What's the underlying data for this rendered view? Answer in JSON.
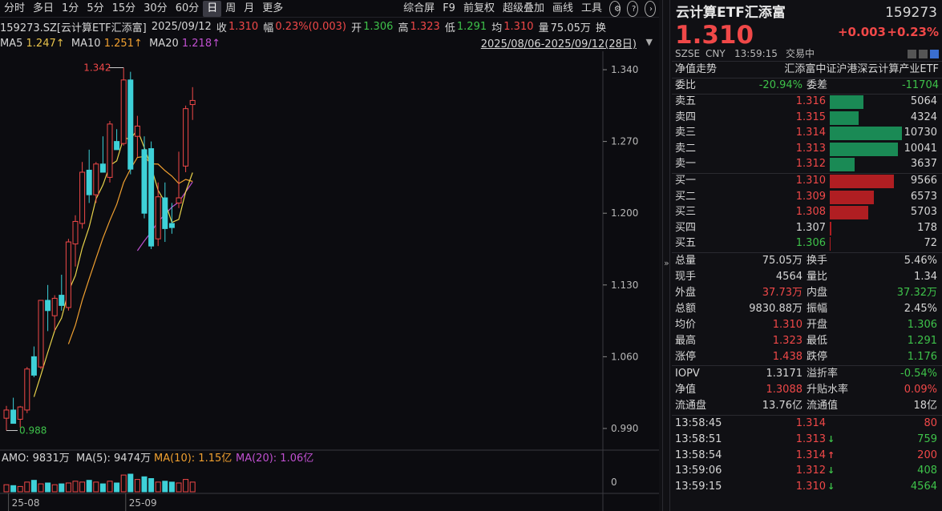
{
  "toolbar": {
    "timeframes": [
      "分时",
      "多日",
      "1分",
      "5分",
      "15分",
      "30分",
      "60分",
      "日",
      "周",
      "月",
      "更多"
    ],
    "active": "日",
    "tools": [
      "综合屏",
      "F9",
      "前复权",
      "超级叠加",
      "画线",
      "工具"
    ]
  },
  "info": {
    "code": "159273.SZ[云计算ETF汇添富]",
    "date": "2025/09/12",
    "close_label": "收",
    "close": "1.310",
    "amp_label": "幅",
    "amp": "0.23%(0.003)",
    "open_label": "开",
    "open": "1.306",
    "high_label": "高",
    "high": "1.323",
    "low_label": "低",
    "low": "1.291",
    "avg_label": "均",
    "avg": "1.310",
    "vol_label": "量",
    "vol": "75.05万",
    "more": "换"
  },
  "ma": {
    "ma5_label": "MA5",
    "ma5": "1.247↑",
    "ma10_label": "MA10",
    "ma10": "1.251↑",
    "ma20_label": "MA20",
    "ma20": "1.218↑"
  },
  "date_range": "2025/08/06-2025/09/12(28日)",
  "chart_data": {
    "type": "candlestick",
    "yticks": [
      "1.340",
      "1.270",
      "1.200",
      "1.130",
      "1.060",
      "0.990"
    ],
    "ylim": [
      0.972,
      1.358
    ],
    "max_label": "1.342",
    "min_label": "0.988",
    "candles": [
      {
        "o": 1.0,
        "h": 1.012,
        "l": 0.988,
        "c": 1.008
      },
      {
        "o": 1.008,
        "h": 1.02,
        "l": 0.995,
        "c": 0.995
      },
      {
        "o": 0.999,
        "h": 1.012,
        "l": 0.991,
        "c": 1.011
      },
      {
        "o": 1.008,
        "h": 1.05,
        "l": 1.005,
        "c": 1.048
      },
      {
        "o": 1.06,
        "h": 1.07,
        "l": 1.04,
        "c": 1.042
      },
      {
        "o": 1.05,
        "h": 1.115,
        "l": 1.048,
        "c": 1.115
      },
      {
        "o": 1.115,
        "h": 1.13,
        "l": 1.085,
        "c": 1.105
      },
      {
        "o": 1.1,
        "h": 1.12,
        "l": 1.085,
        "c": 1.117
      },
      {
        "o": 1.12,
        "h": 1.14,
        "l": 1.105,
        "c": 1.11
      },
      {
        "o": 1.108,
        "h": 1.175,
        "l": 1.105,
        "c": 1.172
      },
      {
        "o": 1.17,
        "h": 1.198,
        "l": 1.148,
        "c": 1.192
      },
      {
        "o": 1.19,
        "h": 1.25,
        "l": 1.185,
        "c": 1.24
      },
      {
        "o": 1.242,
        "h": 1.262,
        "l": 1.21,
        "c": 1.218
      },
      {
        "o": 1.218,
        "h": 1.25,
        "l": 1.21,
        "c": 1.248
      },
      {
        "o": 1.248,
        "h": 1.275,
        "l": 1.24,
        "c": 1.24
      },
      {
        "o": 1.235,
        "h": 1.29,
        "l": 1.23,
        "c": 1.287
      },
      {
        "o": 1.27,
        "h": 1.282,
        "l": 1.262,
        "c": 1.262
      },
      {
        "o": 1.268,
        "h": 1.342,
        "l": 1.266,
        "c": 1.33
      },
      {
        "o": 1.33,
        "h": 1.338,
        "l": 1.238,
        "c": 1.243
      },
      {
        "o": 1.275,
        "h": 1.295,
        "l": 1.255,
        "c": 1.285
      },
      {
        "o": 1.262,
        "h": 1.275,
        "l": 1.195,
        "c": 1.2
      },
      {
        "o": 1.263,
        "h": 1.27,
        "l": 1.165,
        "c": 1.168
      },
      {
        "o": 1.175,
        "h": 1.23,
        "l": 1.168,
        "c": 1.216
      },
      {
        "o": 1.215,
        "h": 1.23,
        "l": 1.172,
        "c": 1.185
      },
      {
        "o": 1.19,
        "h": 1.21,
        "l": 1.18,
        "c": 1.186
      },
      {
        "o": 1.21,
        "h": 1.26,
        "l": 1.205,
        "c": 1.215
      },
      {
        "o": 1.246,
        "h": 1.305,
        "l": 1.24,
        "c": 1.302
      },
      {
        "o": 1.306,
        "h": 1.323,
        "l": 1.291,
        "c": 1.31
      }
    ],
    "ma5_start_index": 4,
    "ma10_start_index": 9,
    "ma20_start_index": 19,
    "ma5_color": "#e8d24a",
    "ma10_color": "#f0a030",
    "ma20_color": "#c050d0",
    "up_color": "#f04848",
    "down_color": "#3ed1d8",
    "volumes": [
      0.4,
      0.35,
      0.3,
      0.55,
      0.65,
      0.45,
      0.5,
      0.4,
      0.45,
      0.5,
      0.6,
      0.55,
      0.65,
      0.55,
      0.45,
      0.6,
      0.5,
      0.95,
      1.0,
      0.7,
      0.85,
      0.75,
      0.55,
      0.6,
      0.55,
      0.5,
      0.7,
      0.55
    ],
    "xticks": [
      {
        "label": "25-08",
        "index": 1
      },
      {
        "label": "25-09",
        "index": 18
      }
    ],
    "vol_zero": "0"
  },
  "amo": {
    "label": "AMO:",
    "value": "9831万",
    "ma5": "MA(5): 9474万",
    "ma10": "MA(10): 1.15亿",
    "ma20": "MA(20): 1.06亿"
  },
  "panel": {
    "name": "云计算ETF汇添富",
    "code": "159273",
    "price": "1.310",
    "change": "+0.003",
    "change_pct": "+0.23%",
    "market": "SZSE",
    "currency": "CNY",
    "time": "13:59:15",
    "status": "交易中",
    "nav_trend": "净值走势",
    "index_name": "汇添富中证沪港深云计算产业ETF",
    "webi_label": "委比",
    "webi": "-20.94%",
    "wecha_label": "委差",
    "wecha": "-11704",
    "asks": [
      {
        "label": "卖五",
        "price": "1.316",
        "vol": "5064",
        "ratio": 0.47
      },
      {
        "label": "卖四",
        "price": "1.315",
        "vol": "4324",
        "ratio": 0.4
      },
      {
        "label": "卖三",
        "price": "1.314",
        "vol": "10730",
        "ratio": 1.0
      },
      {
        "label": "卖二",
        "price": "1.313",
        "vol": "10041",
        "ratio": 0.94
      },
      {
        "label": "卖一",
        "price": "1.312",
        "vol": "3637",
        "ratio": 0.34
      }
    ],
    "bids": [
      {
        "label": "买一",
        "price": "1.310",
        "vol": "9566",
        "ratio": 0.89,
        "color": "r"
      },
      {
        "label": "买二",
        "price": "1.309",
        "vol": "6573",
        "ratio": 0.61,
        "color": "r"
      },
      {
        "label": "买三",
        "price": "1.308",
        "vol": "5703",
        "ratio": 0.53,
        "color": "r"
      },
      {
        "label": "买四",
        "price": "1.307",
        "vol": "178",
        "ratio": 0.02,
        "color": "w"
      },
      {
        "label": "买五",
        "price": "1.306",
        "vol": "72",
        "ratio": 0.01,
        "color": "g"
      }
    ],
    "stats": [
      {
        "l1": "总量",
        "v1": "75.05万",
        "c1": "w",
        "l2": "换手",
        "v2": "5.46%",
        "c2": "w"
      },
      {
        "l1": "现手",
        "v1": "4564",
        "c1": "w",
        "l2": "量比",
        "v2": "1.34",
        "c2": "w"
      },
      {
        "l1": "外盘",
        "v1": "37.73万",
        "c1": "r",
        "l2": "内盘",
        "v2": "37.32万",
        "c2": "g"
      },
      {
        "l1": "总额",
        "v1": "9830.88万",
        "c1": "w",
        "l2": "振幅",
        "v2": "2.45%",
        "c2": "w"
      },
      {
        "l1": "均价",
        "v1": "1.310",
        "c1": "r",
        "l2": "开盘",
        "v2": "1.306",
        "c2": "g"
      },
      {
        "l1": "最高",
        "v1": "1.323",
        "c1": "r",
        "l2": "最低",
        "v2": "1.291",
        "c2": "g"
      },
      {
        "l1": "涨停",
        "v1": "1.438",
        "c1": "r",
        "l2": "跌停",
        "v2": "1.176",
        "c2": "g"
      }
    ],
    "iopv": [
      {
        "l1": "IOPV",
        "v1": "1.3171",
        "c1": "w",
        "l2": "溢折率",
        "v2": "-0.54%",
        "c2": "g"
      },
      {
        "l1": "净值",
        "v1": "1.3088",
        "c1": "r",
        "l2": "升贴水率",
        "v2": "0.09%",
        "c2": "r"
      },
      {
        "l1": "流通盘",
        "v1": "13.76亿",
        "c1": "w",
        "l2": "流通值",
        "v2": "18亿",
        "c2": "w"
      }
    ],
    "ticks": [
      {
        "time": "13:58:45",
        "price": "1.314",
        "arrow": "",
        "vol": "80",
        "vc": "r"
      },
      {
        "time": "13:58:51",
        "price": "1.313",
        "arrow": "↓",
        "ac": "g",
        "vol": "759",
        "vc": "g"
      },
      {
        "time": "13:58:54",
        "price": "1.314",
        "arrow": "↑",
        "ac": "r",
        "vol": "200",
        "vc": "r"
      },
      {
        "time": "13:59:06",
        "price": "1.312",
        "arrow": "↓",
        "ac": "g",
        "vol": "408",
        "vc": "g"
      },
      {
        "time": "13:59:15",
        "price": "1.310",
        "arrow": "↓",
        "ac": "g",
        "vol": "4564",
        "vc": "g"
      }
    ]
  }
}
